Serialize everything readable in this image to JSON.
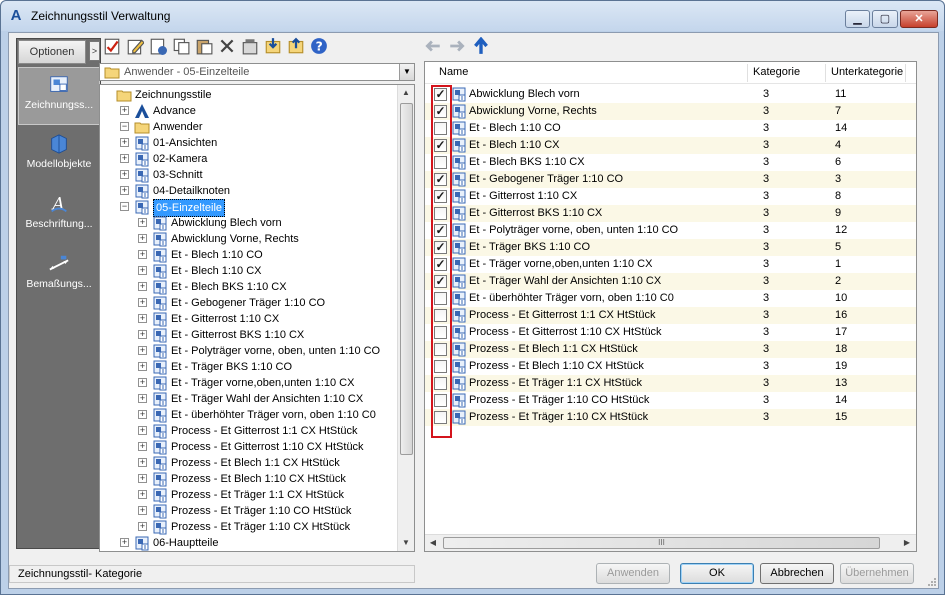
{
  "window": {
    "title": "Zeichnungsstil Verwaltung",
    "app_icon": "autocad-a-icon",
    "controls": [
      "minimize",
      "maximize",
      "close"
    ]
  },
  "sidebar": {
    "options_label": "Optionen",
    "collapse_glyph": ">",
    "items": [
      {
        "label": "Zeichnungss...",
        "icon": "drawing-style-icon",
        "active": true
      },
      {
        "label": "Modellobjekte",
        "icon": "model-objects-icon",
        "active": false
      },
      {
        "label": "Beschriftung...",
        "icon": "annotation-icon",
        "active": false
      },
      {
        "label": "Bemaßungs...",
        "icon": "dimension-icon",
        "active": false
      }
    ]
  },
  "toolbar": {
    "buttons": [
      "check-style-icon",
      "edit-style-icon",
      "new-style-icon",
      "copy-icon",
      "paste-icon",
      "delete-icon",
      "purge-icon",
      "import-icon",
      "export-icon",
      "help-icon"
    ],
    "nav": [
      "back-arrow-icon",
      "forward-arrow-icon",
      "up-arrow-icon"
    ]
  },
  "combo": {
    "value": "Anwender - 05-Einzelteile"
  },
  "tree": [
    {
      "label": "Zeichnungsstile",
      "level": 0,
      "expander": "",
      "icon": "folder"
    },
    {
      "label": "Advance",
      "level": 1,
      "expander": "+",
      "icon": "app"
    },
    {
      "label": "Anwender",
      "level": 1,
      "expander": "-",
      "icon": "folder"
    },
    {
      "label": "01-Ansichten",
      "level": 2,
      "expander": "+",
      "icon": "style"
    },
    {
      "label": "02-Kamera",
      "level": 2,
      "expander": "+",
      "icon": "style"
    },
    {
      "label": "03-Schnitt",
      "level": 2,
      "expander": "+",
      "icon": "style"
    },
    {
      "label": "04-Detailknoten",
      "level": 2,
      "expander": "+",
      "icon": "style"
    },
    {
      "label": "05-Einzelteile",
      "level": 2,
      "expander": "-",
      "icon": "style",
      "selected": true
    },
    {
      "label": "Abwicklung Blech vorn",
      "level": 3,
      "expander": "+",
      "icon": "style"
    },
    {
      "label": "Abwicklung Vorne, Rechts",
      "level": 3,
      "expander": "+",
      "icon": "style"
    },
    {
      "label": "Et - Blech 1:10 CO",
      "level": 3,
      "expander": "+",
      "icon": "style"
    },
    {
      "label": "Et - Blech 1:10 CX",
      "level": 3,
      "expander": "+",
      "icon": "style"
    },
    {
      "label": "Et - Blech BKS 1:10 CX",
      "level": 3,
      "expander": "+",
      "icon": "style"
    },
    {
      "label": "Et - Gebogener Träger 1:10 CO",
      "level": 3,
      "expander": "+",
      "icon": "style"
    },
    {
      "label": "Et - Gitterrost 1:10 CX",
      "level": 3,
      "expander": "+",
      "icon": "style"
    },
    {
      "label": "Et - Gitterrost BKS 1:10 CX",
      "level": 3,
      "expander": "+",
      "icon": "style"
    },
    {
      "label": "Et - Polyträger vorne, oben, unten 1:10 CO",
      "level": 3,
      "expander": "+",
      "icon": "style"
    },
    {
      "label": "Et - Träger BKS 1:10 CO",
      "level": 3,
      "expander": "+",
      "icon": "style"
    },
    {
      "label": "Et - Träger vorne,oben,unten 1:10 CX",
      "level": 3,
      "expander": "+",
      "icon": "style"
    },
    {
      "label": "Et - Träger Wahl der Ansichten 1:10 CX",
      "level": 3,
      "expander": "+",
      "icon": "style"
    },
    {
      "label": "Et - überhöhter Träger vorn, oben 1:10 C0",
      "level": 3,
      "expander": "+",
      "icon": "style"
    },
    {
      "label": "Process - Et Gitterrost 1:1 CX HtStück",
      "level": 3,
      "expander": "+",
      "icon": "style"
    },
    {
      "label": "Process - Et Gitterrost 1:10 CX HtStück",
      "level": 3,
      "expander": "+",
      "icon": "style"
    },
    {
      "label": "Prozess - Et Blech 1:1 CX HtStück",
      "level": 3,
      "expander": "+",
      "icon": "style"
    },
    {
      "label": "Prozess - Et Blech 1:10 CX HtStück",
      "level": 3,
      "expander": "+",
      "icon": "style"
    },
    {
      "label": "Prozess - Et Träger 1:1 CX HtStück",
      "level": 3,
      "expander": "+",
      "icon": "style"
    },
    {
      "label": "Prozess - Et Träger 1:10 CO HtStück",
      "level": 3,
      "expander": "+",
      "icon": "style"
    },
    {
      "label": "Prozess - Et Träger 1:10 CX HtStück",
      "level": 3,
      "expander": "+",
      "icon": "style"
    },
    {
      "label": "06-Hauptteile",
      "level": 2,
      "expander": "+",
      "icon": "style"
    }
  ],
  "list": {
    "columns": {
      "name": "Name",
      "kategorie": "Kategorie",
      "unterkategorie": "Unterkategorie"
    },
    "rows": [
      {
        "checked": true,
        "name": "Abwicklung Blech vorn",
        "kategorie": "3",
        "unterkategorie": "11"
      },
      {
        "checked": true,
        "name": "Abwicklung Vorne, Rechts",
        "kategorie": "3",
        "unterkategorie": "7"
      },
      {
        "checked": false,
        "name": "Et - Blech 1:10 CO",
        "kategorie": "3",
        "unterkategorie": "14"
      },
      {
        "checked": true,
        "name": "Et - Blech 1:10 CX",
        "kategorie": "3",
        "unterkategorie": "4"
      },
      {
        "checked": false,
        "name": "Et - Blech BKS 1:10 CX",
        "kategorie": "3",
        "unterkategorie": "6"
      },
      {
        "checked": true,
        "name": "Et - Gebogener Träger 1:10 CO",
        "kategorie": "3",
        "unterkategorie": "3"
      },
      {
        "checked": true,
        "name": "Et - Gitterrost 1:10 CX",
        "kategorie": "3",
        "unterkategorie": "8"
      },
      {
        "checked": false,
        "name": "Et - Gitterrost BKS 1:10 CX",
        "kategorie": "3",
        "unterkategorie": "9"
      },
      {
        "checked": true,
        "name": "Et - Polyträger vorne, oben, unten 1:10 CO",
        "kategorie": "3",
        "unterkategorie": "12"
      },
      {
        "checked": true,
        "name": "Et - Träger BKS 1:10 CO",
        "kategorie": "3",
        "unterkategorie": "5"
      },
      {
        "checked": true,
        "name": "Et - Träger vorne,oben,unten 1:10 CX",
        "kategorie": "3",
        "unterkategorie": "1"
      },
      {
        "checked": true,
        "name": "Et - Träger Wahl der Ansichten 1:10 CX",
        "kategorie": "3",
        "unterkategorie": "2"
      },
      {
        "checked": false,
        "name": "Et - überhöhter Träger vorn, oben 1:10 C0",
        "kategorie": "3",
        "unterkategorie": "10"
      },
      {
        "checked": false,
        "name": "Process - Et Gitterrost 1:1 CX HtStück",
        "kategorie": "3",
        "unterkategorie": "16"
      },
      {
        "checked": false,
        "name": "Process - Et Gitterrost 1:10 CX HtStück",
        "kategorie": "3",
        "unterkategorie": "17"
      },
      {
        "checked": false,
        "name": "Prozess - Et Blech 1:1 CX HtStück",
        "kategorie": "3",
        "unterkategorie": "18"
      },
      {
        "checked": false,
        "name": "Prozess - Et Blech 1:10 CX HtStück",
        "kategorie": "3",
        "unterkategorie": "19"
      },
      {
        "checked": false,
        "name": "Prozess - Et Träger 1:1 CX HtStück",
        "kategorie": "3",
        "unterkategorie": "13"
      },
      {
        "checked": false,
        "name": "Prozess - Et Träger 1:10 CO HtStück",
        "kategorie": "3",
        "unterkategorie": "14"
      },
      {
        "checked": false,
        "name": "Prozess - Et Träger 1:10 CX HtStück",
        "kategorie": "3",
        "unterkategorie": "15"
      }
    ],
    "hscroll_grip": "III"
  },
  "status": {
    "text": "Zeichnungsstil- Kategorie"
  },
  "buttons": {
    "apply": "Anwenden",
    "ok": "OK",
    "cancel": "Abbrechen",
    "take_over": "Übernehmen"
  },
  "colors": {
    "highlight_box": "#d4141c",
    "selection": "#3399ff",
    "alt_row": "#fbf8e6"
  }
}
